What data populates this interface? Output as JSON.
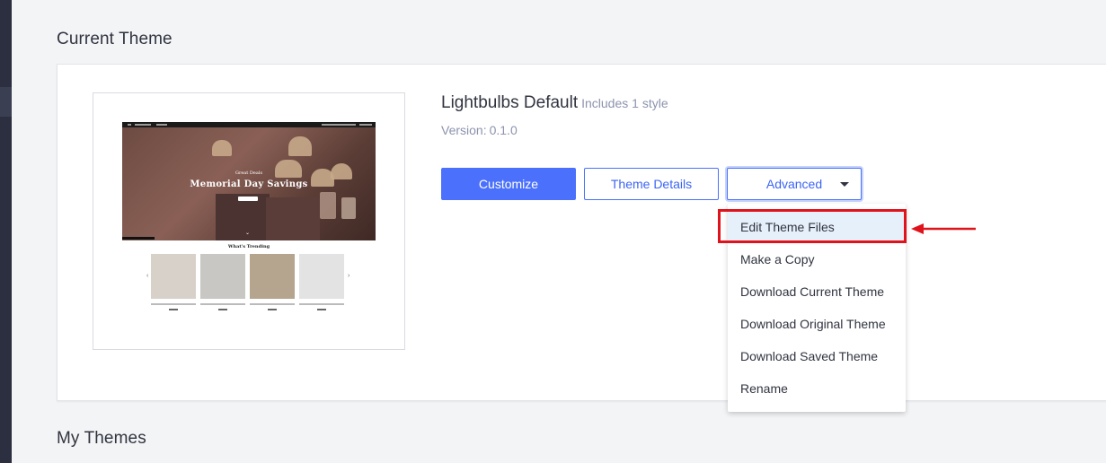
{
  "sections": {
    "current_theme_heading": "Current Theme",
    "my_themes_heading": "My Themes"
  },
  "theme": {
    "name": "Lightbulbs Default",
    "styles_note": "Includes 1 style",
    "version_label": "Version:",
    "version_value": "0.1.0"
  },
  "preview": {
    "hero_kicker": "Great Deals",
    "hero_title": "Memorial Day Savings",
    "trending_title": "What's Trending"
  },
  "buttons": {
    "customize": "Customize",
    "theme_details": "Theme Details",
    "advanced": "Advanced"
  },
  "advanced_menu": {
    "items": [
      "Edit Theme Files",
      "Make a Copy",
      "Download Current Theme",
      "Download Original Theme",
      "Download Saved Theme",
      "Rename"
    ],
    "highlighted_item": "Edit Theme Files"
  },
  "annotation": {
    "highlight_color": "#e0121b"
  },
  "colors": {
    "primary": "#4b71fc",
    "background": "#f3f4f6",
    "text": "#313440",
    "muted": "#8c93ad"
  }
}
